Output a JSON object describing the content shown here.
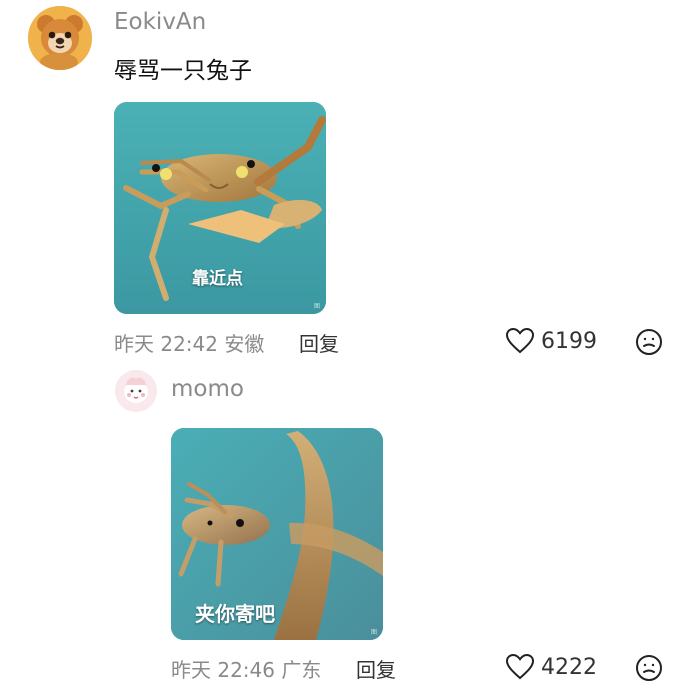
{
  "comment": {
    "username": "EokivAn",
    "text": "辱骂一只兔子",
    "image_caption": "靠近点",
    "meta": "昨天 22:42 安徽",
    "reply_label": "回复",
    "like_count": "6199",
    "avatar_icon": "bear-avatar-icon",
    "more_icon": "face-icon",
    "image_watermark": "图"
  },
  "reply": {
    "username": "momo",
    "image_caption": "夹你寄吧",
    "meta": "昨天 22:46 广东",
    "reply_label": "回复",
    "like_count": "4222",
    "avatar_icon": "cartoon-avatar-icon",
    "more_icon": "face-icon",
    "image_watermark": "图"
  },
  "colors": {
    "username": "#8a8a8a",
    "meta": "#8a8a8a",
    "primary_text": "#111111",
    "image_background": "#3e9fa7"
  }
}
